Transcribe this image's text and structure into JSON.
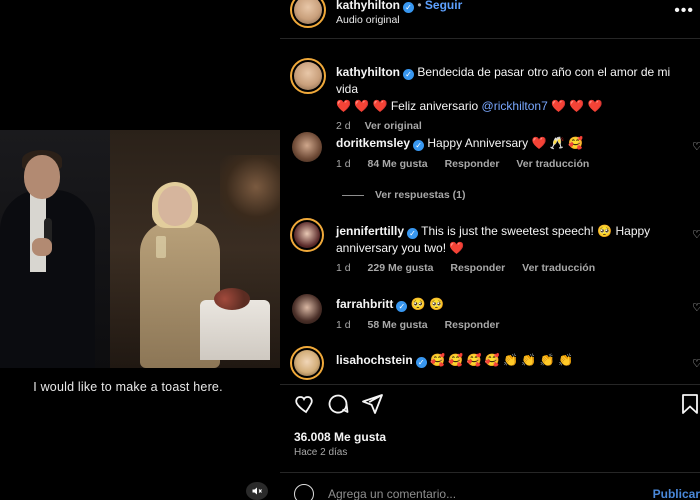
{
  "video": {
    "subtitle": "I would like to make a toast here."
  },
  "post": {
    "username": "kathyhilton",
    "follow_label": "Seguir",
    "audio_label": "Audio original",
    "caption_user": "kathyhilton",
    "caption_line1": "Bendecida de pasar otro año con el amor de mi vida",
    "caption_line2_prefix": "❤️ ❤️ ❤️ Feliz aniversario",
    "caption_mention": "@rickhilton7",
    "caption_line2_suffix": "❤️ ❤️ ❤️",
    "caption_time": "2 d",
    "caption_original": "Ver original"
  },
  "comments": [
    {
      "user": "doritkemsley",
      "text": "Happy Anniversary ❤️ 🥂 🥰",
      "time": "1 d",
      "likes": "84 Me gusta",
      "reply": "Responder",
      "translate": "Ver traducción",
      "replies": "Ver respuestas (1)"
    },
    {
      "user": "jenniferttilly",
      "text_line1": "This is just the sweetest speech! 🥺 Happy",
      "text_line2": "anniversary you two! ❤️",
      "time": "1 d",
      "likes": "229 Me gusta",
      "reply": "Responder",
      "translate": "Ver traducción"
    },
    {
      "user": "farrahbritt",
      "text": "🥺 🥺",
      "time": "1 d",
      "likes": "58 Me gusta",
      "reply": "Responder"
    },
    {
      "user": "lisahochstein",
      "text": "🥰 🥰 🥰 🥰 👏 👏 👏 👏"
    }
  ],
  "footer": {
    "likes": "36.008 Me gusta",
    "time_ago": "Hace 2 días",
    "add_comment_placeholder": "Agrega un comentario...",
    "publish_label": "Publicar"
  }
}
